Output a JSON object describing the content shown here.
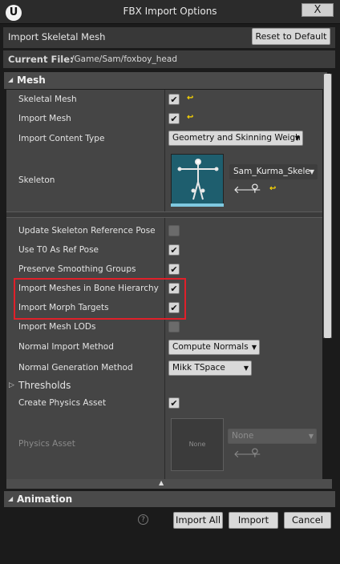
{
  "window": {
    "logo": "U",
    "title": "FBX Import Options",
    "close": "X"
  },
  "header": {
    "label": "Import Skeletal Mesh",
    "reset_label": "Reset to Default"
  },
  "current_file": {
    "label": "Current File:",
    "value": "/Game/Sam/foxboy_head"
  },
  "mesh_category": {
    "title": "Mesh",
    "skeletal_mesh": {
      "label": "Skeletal Mesh",
      "checked": true
    },
    "import_mesh": {
      "label": "Import Mesh",
      "checked": true
    },
    "import_content_type": {
      "label": "Import Content Type",
      "value": "Geometry and Skinning Weigh"
    },
    "skeleton": {
      "label": "Skeleton",
      "value": "Sam_Kurma_Skele"
    },
    "update_skeleton_ref_pose": {
      "label": "Update Skeleton Reference Pose",
      "checked": false
    },
    "use_t0_as_ref_pose": {
      "label": "Use T0 As Ref Pose",
      "checked": true
    },
    "preserve_smoothing_groups": {
      "label": "Preserve Smoothing Groups",
      "checked": true
    },
    "import_meshes_in_bone_hierarchy": {
      "label": "Import Meshes in Bone Hierarchy",
      "checked": true
    },
    "import_morph_targets": {
      "label": "Import Morph Targets",
      "checked": true
    },
    "import_mesh_lods": {
      "label": "Import Mesh LODs",
      "checked": false
    },
    "normal_import_method": {
      "label": "Normal Import Method",
      "value": "Compute Normals"
    },
    "normal_generation_method": {
      "label": "Normal Generation Method",
      "value": "Mikk TSpace"
    },
    "thresholds": {
      "label": "Thresholds"
    },
    "create_physics_asset": {
      "label": "Create Physics Asset",
      "checked": true
    },
    "physics_asset": {
      "label": "Physics Asset",
      "thumb_text": "None",
      "value": "None"
    }
  },
  "animation_category": {
    "title": "Animation"
  },
  "footer": {
    "import_all": "Import All",
    "import": "Import",
    "cancel": "Cancel",
    "help": "?"
  },
  "colors": {
    "highlight": "#e0202a",
    "reset_arrow": "#ffd900",
    "skeleton_thumb": "#1e5e6e"
  },
  "icons": [
    "ue-logo-icon",
    "close-icon",
    "reset-arrow-icon",
    "use-selected-arrow-icon",
    "browse-search-icon",
    "expand-arrow-icon",
    "help-icon"
  ]
}
